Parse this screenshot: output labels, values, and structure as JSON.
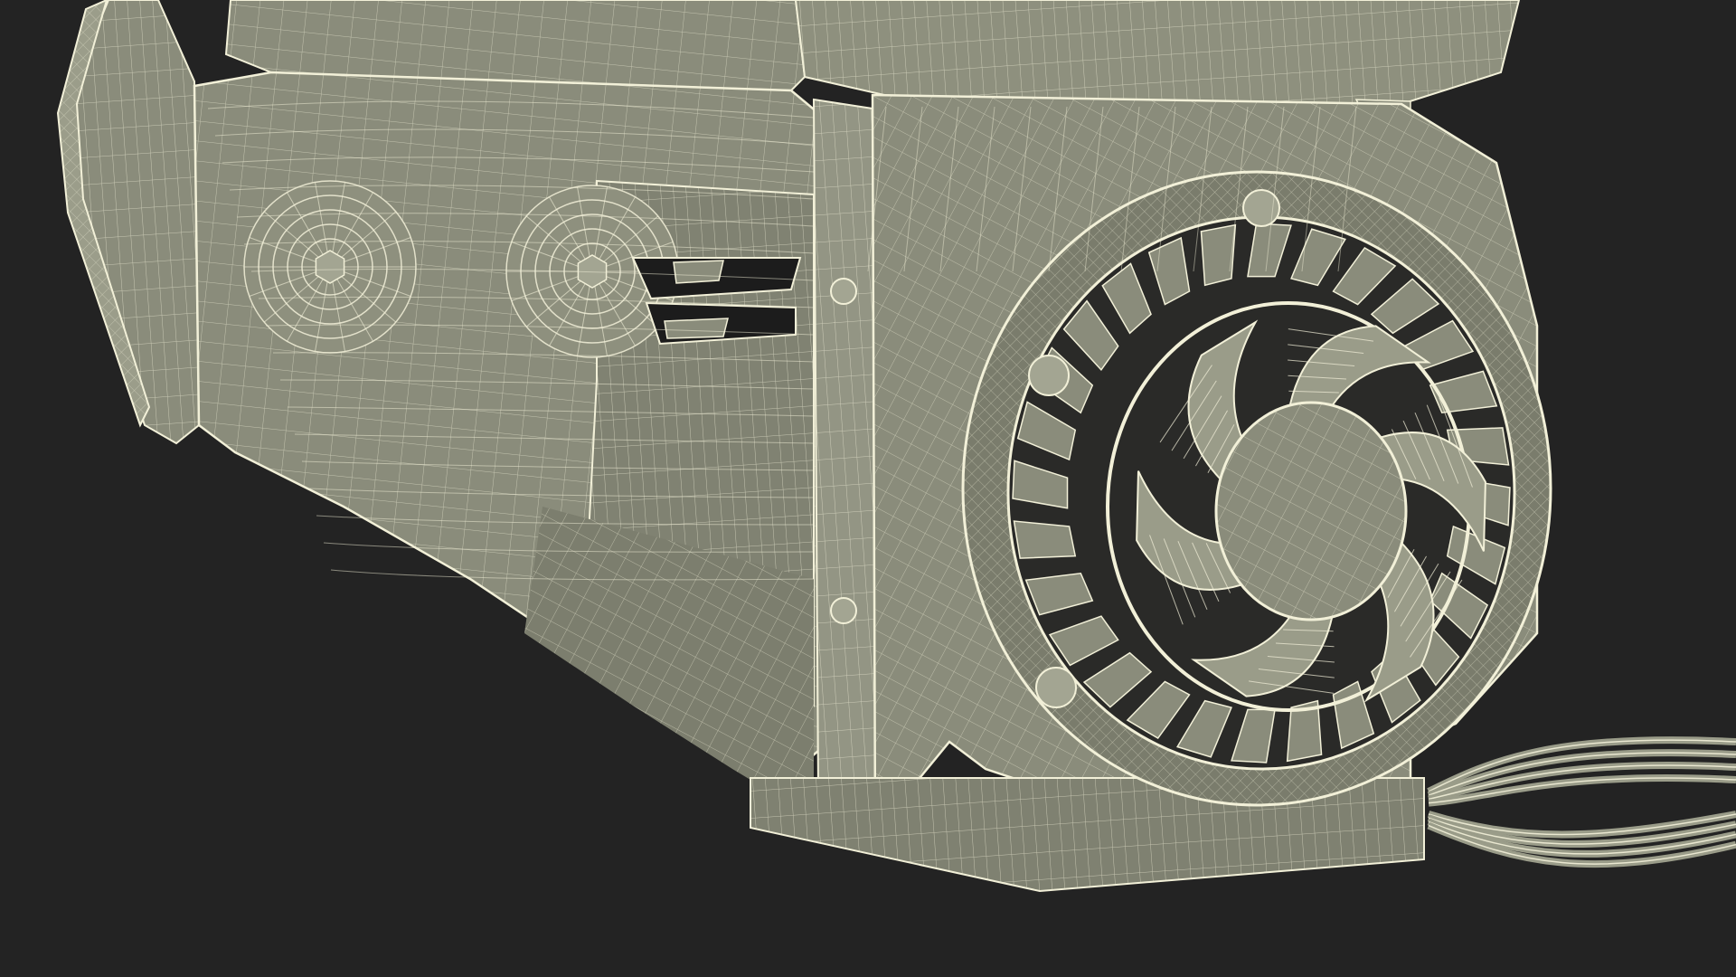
{
  "scene": {
    "background_color": "#232323",
    "model_fill_color": "#8a8c7b",
    "model_shadow_color": "#6d6f60",
    "model_highlight_color": "#a3a592",
    "wire_color": "#f2f0d8",
    "slot_color": "#1c1c1c",
    "cable_count": 4,
    "fan_fin_count": 28
  }
}
